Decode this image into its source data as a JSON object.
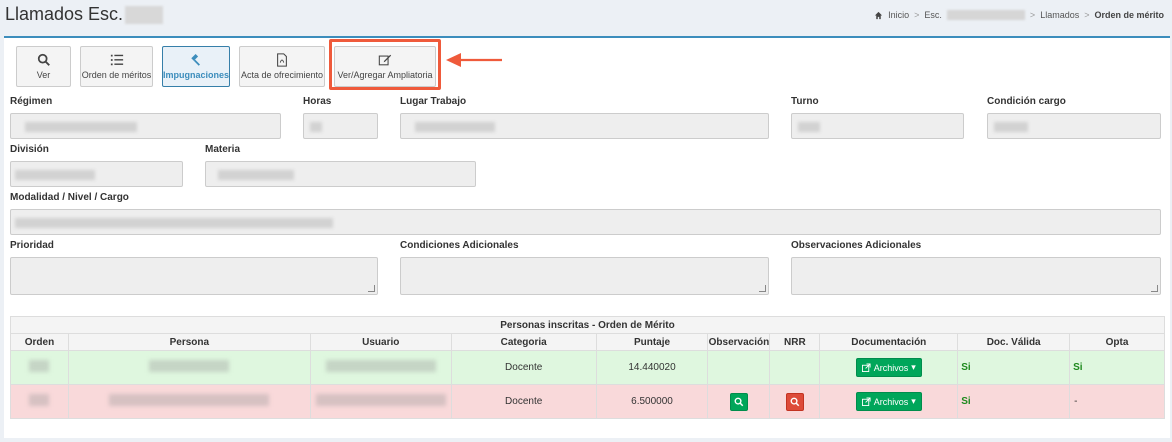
{
  "header": {
    "title": "Llamados Esc.",
    "breadcrumb": [
      "Inicio",
      "Esc.",
      "Llamados",
      "Orden de mérito"
    ]
  },
  "toolbar": {
    "buttons": [
      {
        "label": "Ver",
        "icon": "search-icon"
      },
      {
        "label": "Orden de méritos",
        "icon": "list-ordered-icon"
      },
      {
        "label": "Impugnaciones",
        "icon": "gavel-icon"
      },
      {
        "label": "Acta de ofrecimiento",
        "icon": "pdf-file-icon"
      },
      {
        "label": "Ver/Agregar Ampliatoria",
        "icon": "edit-icon"
      }
    ],
    "active_index": 2
  },
  "form": {
    "regimen": "Régimen",
    "horas": "Horas",
    "lugar_trabajo": "Lugar Trabajo",
    "turno": "Turno",
    "condicion_cargo": "Condición cargo",
    "division": "División",
    "materia": "Materia",
    "modalidad": "Modalidad / Nivel / Cargo",
    "prioridad": "Prioridad",
    "condiciones_adicionales": "Condiciones Adicionales",
    "observaciones_adicionales": "Observaciones Adicionales"
  },
  "table": {
    "caption": "Personas inscritas - Orden de Mérito",
    "columns": [
      "Orden",
      "Persona",
      "Usuario",
      "Categoria",
      "Puntaje",
      "Observación",
      "NRR",
      "Documentación",
      "Doc. Válida",
      "Opta"
    ],
    "rows": [
      {
        "categoria": "Docente",
        "puntaje": "14.440020",
        "archivos": "Archivos",
        "doc_valida": "Si",
        "opta": "Si"
      },
      {
        "categoria": "Docente",
        "puntaje": "6.500000",
        "archivos": "Archivos",
        "doc_valida": "Si",
        "opta": "-"
      }
    ]
  },
  "colors": {
    "accent": "#3c8dbc",
    "success": "#00a65a",
    "danger": "#dd4b39",
    "highlight": "#ef5a3b"
  }
}
